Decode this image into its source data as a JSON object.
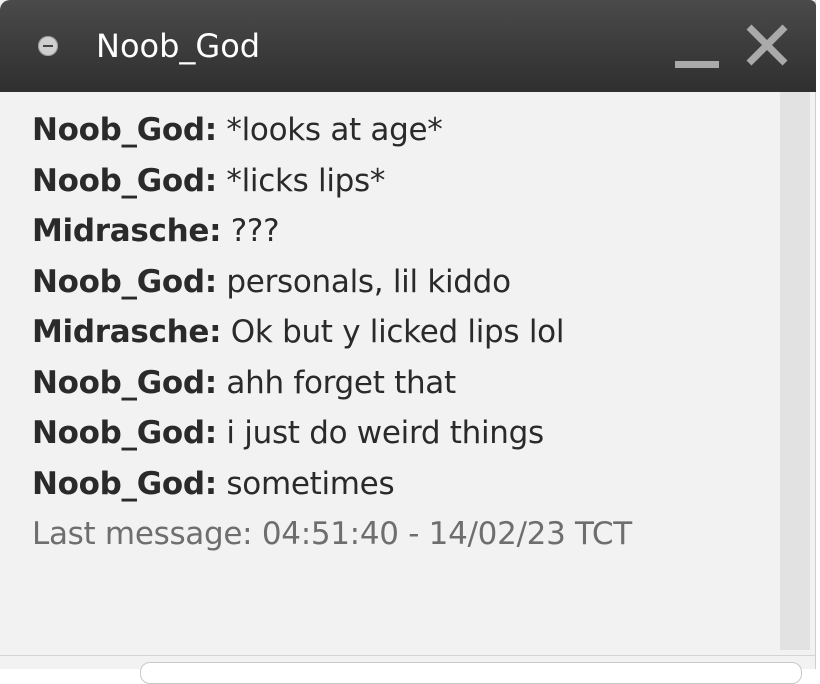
{
  "window": {
    "title": "Noob_God"
  },
  "messages": [
    {
      "sender": "Noob_God:",
      "text": "*looks at age*"
    },
    {
      "sender": "Noob_God:",
      "text": "*licks lips*"
    },
    {
      "sender": "Midrasche:",
      "text": "???"
    },
    {
      "sender": "Noob_God:",
      "text": "personals, lil kiddo"
    },
    {
      "sender": "Midrasche:",
      "text": "Ok but y licked lips lol"
    },
    {
      "sender": "Noob_God:",
      "text": "ahh forget that"
    },
    {
      "sender": "Noob_God:",
      "text": "i just do weird things"
    },
    {
      "sender": "Noob_God:",
      "text": "sometimes"
    }
  ],
  "last_message": "Last message: 04:51:40 - 14/02/23 TCT",
  "colors": {
    "titlebar": "#3a3a3a",
    "background": "#f2f2f2",
    "text": "#2a2a2a",
    "muted": "#6e6e6e"
  },
  "icons": {
    "status": "status-dot-icon",
    "minimize": "minimize-icon",
    "close": "close-icon"
  }
}
